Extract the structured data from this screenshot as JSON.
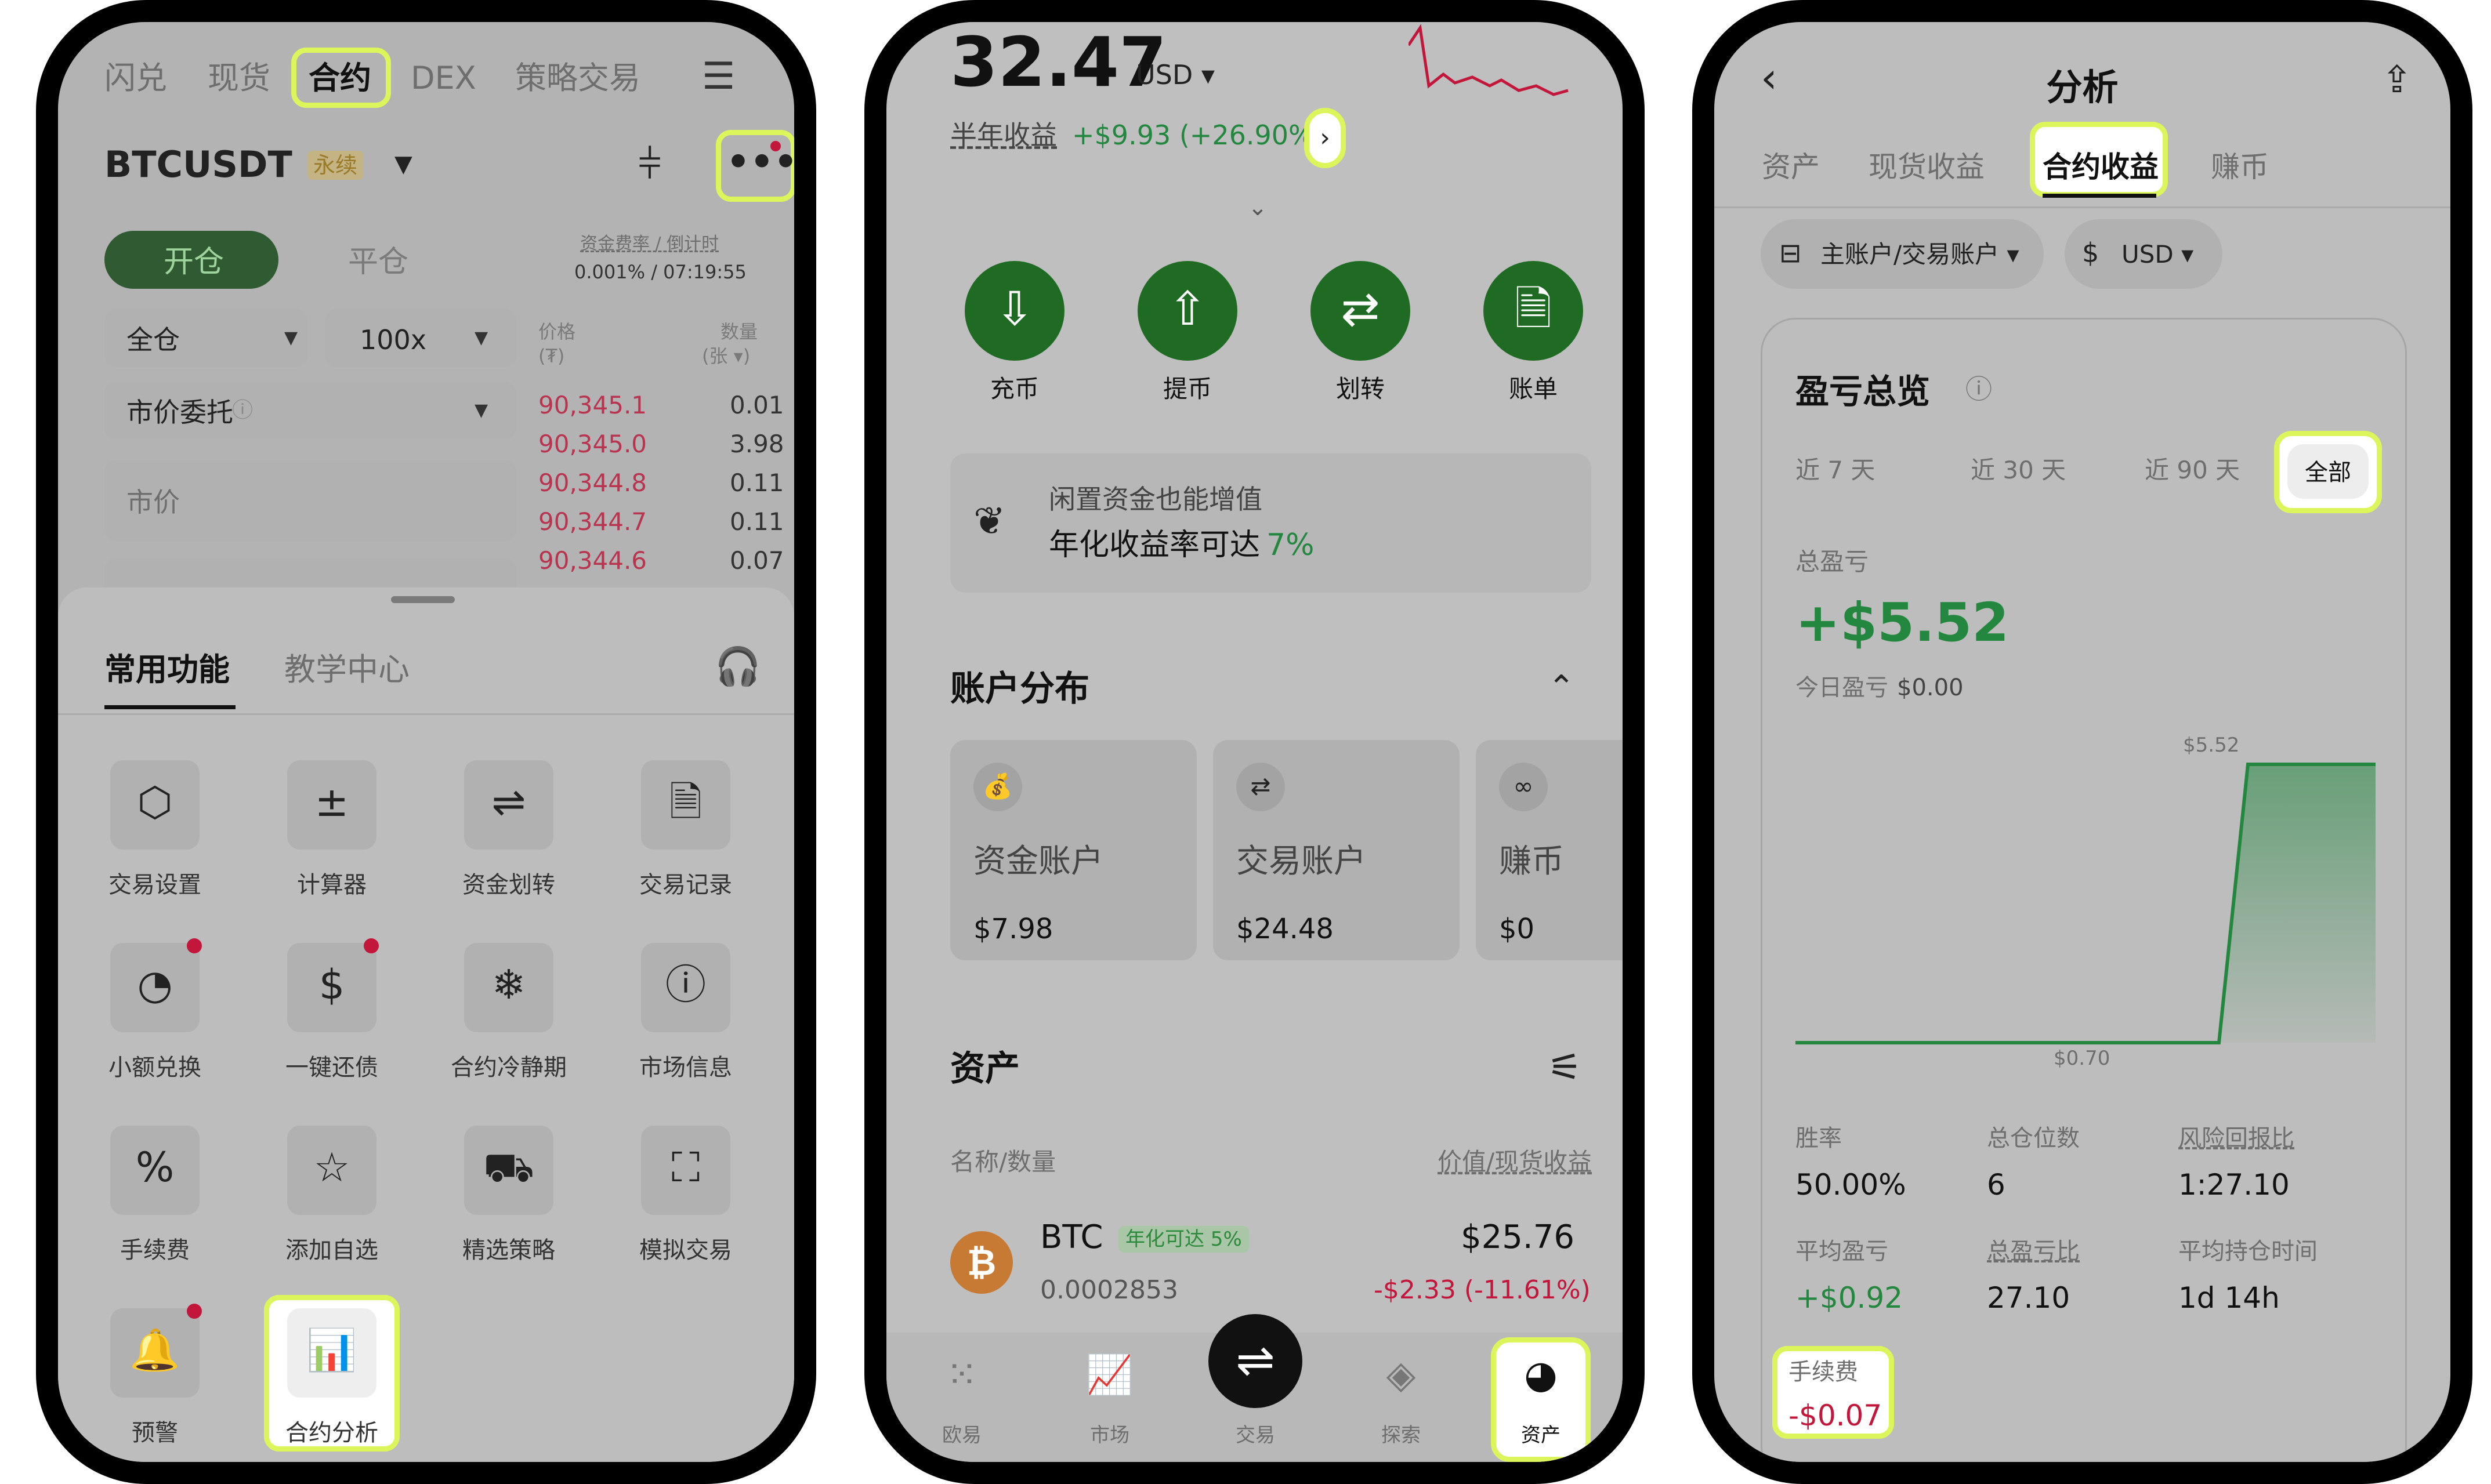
{
  "phone1": {
    "top_tabs": [
      "闪兑",
      "现货",
      "合约",
      "DEX",
      "策略交易"
    ],
    "symbol": "BTCUSDT",
    "symbol_badge": "永续",
    "open_tab": "开仓",
    "close_tab": "平仓",
    "funding_label": "资金费率 / 倒计时",
    "funding_value": "0.001% / 07:19:55",
    "margin_mode": "全仓",
    "leverage": "100x",
    "order_type": "市价委托",
    "price_placeholder": "市价",
    "book_header_price": "价格\n(₮)",
    "book_header_qty": "数量\n(张 ▾)",
    "book_price_label": "价格",
    "book_price_unit": "(₮)",
    "book_qty_label": "数量",
    "book_qty_unit": "(张 ▾)",
    "order_book": [
      {
        "price": "90,345.1",
        "qty": "0.01"
      },
      {
        "price": "90,345.0",
        "qty": "3.98"
      },
      {
        "price": "90,344.8",
        "qty": "0.11"
      },
      {
        "price": "90,344.7",
        "qty": "0.11"
      },
      {
        "price": "90,344.6",
        "qty": "0.07"
      }
    ],
    "sheet_tabs": [
      "常用功能",
      "教学中心"
    ],
    "grid": [
      {
        "label": "交易设置",
        "icon": "⬡",
        "dot": false
      },
      {
        "label": "计算器",
        "icon": "±",
        "dot": false
      },
      {
        "label": "资金划转",
        "icon": "⇌",
        "dot": false
      },
      {
        "label": "交易记录",
        "icon": "🗎",
        "dot": false
      },
      {
        "label": "小额兑换",
        "icon": "◔",
        "dot": true
      },
      {
        "label": "一键还债",
        "icon": "$",
        "dot": true
      },
      {
        "label": "合约冷静期",
        "icon": "❄",
        "dot": false
      },
      {
        "label": "市场信息",
        "icon": "ⓘ",
        "dot": false
      },
      {
        "label": "手续费",
        "icon": "%",
        "dot": false
      },
      {
        "label": "添加自选",
        "icon": "☆",
        "dot": false
      },
      {
        "label": "精选策略",
        "icon": "⛟",
        "dot": false
      },
      {
        "label": "模拟交易",
        "icon": "⛶",
        "dot": false
      },
      {
        "label": "预警",
        "icon": "🔔",
        "dot": true
      },
      {
        "label": "合约分析",
        "icon": "📊",
        "dot": false
      }
    ]
  },
  "phone2": {
    "balance": "32.47",
    "currency": "USD ▾",
    "half_year_label": "半年收益",
    "half_year_value": "+$9.93 (+26.90%)",
    "actions": [
      {
        "label": "充币",
        "icon": "⇩"
      },
      {
        "label": "提币",
        "icon": "⇧"
      },
      {
        "label": "划转",
        "icon": "⇄"
      },
      {
        "label": "账单",
        "icon": "🗎"
      }
    ],
    "promo_line1": "闲置资金也能增值",
    "promo_line2": "年化收益率可达",
    "promo_rate": "7%",
    "dist_title": "账户分布",
    "accounts": [
      {
        "name": "资金账户",
        "value": "$7.98",
        "icon": "💰"
      },
      {
        "name": "交易账户",
        "value": "$24.48",
        "icon": "⇄"
      },
      {
        "name": "赚币",
        "value": "$0",
        "icon": "∞"
      }
    ],
    "assets_title": "资产",
    "col_left": "名称/数量",
    "col_right": "价值/现货收益",
    "asset": {
      "name": "BTC",
      "badge": "年化可达 5%",
      "qty": "0.0002853",
      "value": "$25.76",
      "pnl": "-$2.33 (-11.61%)"
    },
    "nav": [
      {
        "label": "欧易",
        "icon": "⁙"
      },
      {
        "label": "市场",
        "icon": "📈"
      },
      {
        "label": "交易",
        "icon": "⇌"
      },
      {
        "label": "探索",
        "icon": "◈"
      },
      {
        "label": "资产",
        "icon": "◕"
      }
    ]
  },
  "phone3": {
    "title": "分析",
    "tabs": [
      "资产",
      "现货收益",
      "合约收益",
      "赚币"
    ],
    "account_filter": "主账户/交易账户 ▾",
    "currency_filter": "USD ▾",
    "card_title": "盈亏总览",
    "periods": [
      "近 7 天",
      "近 30 天",
      "近 90 天",
      "全部"
    ],
    "total_label": "总盈亏",
    "total_value": "+$5.52",
    "today_label": "今日盈亏",
    "today_value": "$0.00",
    "stats": [
      {
        "label": "胜率",
        "value": "50.00%"
      },
      {
        "label": "总仓位数",
        "value": "6"
      },
      {
        "label": "风险回报比",
        "value": "1:27.10"
      },
      {
        "label": "平均盈亏",
        "value": "+$0.92"
      },
      {
        "label": "总盈亏比",
        "value": "27.10"
      },
      {
        "label": "平均持仓时间",
        "value": "1d 14h"
      }
    ],
    "fee_label": "手续费",
    "fee_value": "-$0.07"
  },
  "chart_data": {
    "type": "area",
    "x": [
      0,
      1,
      2,
      3,
      4,
      5,
      6
    ],
    "values": [
      0.0,
      0.0,
      0.0,
      0.0,
      0.0,
      5.52,
      5.52
    ],
    "max_label": "$5.52",
    "min_label": "$0.70",
    "title": "",
    "xlabel": "",
    "ylabel": ""
  },
  "colors": {
    "accent_green": "#23873f",
    "loss_red": "#c2163b",
    "highlight": "#dcf55b",
    "button_green": "#1f6b24"
  }
}
